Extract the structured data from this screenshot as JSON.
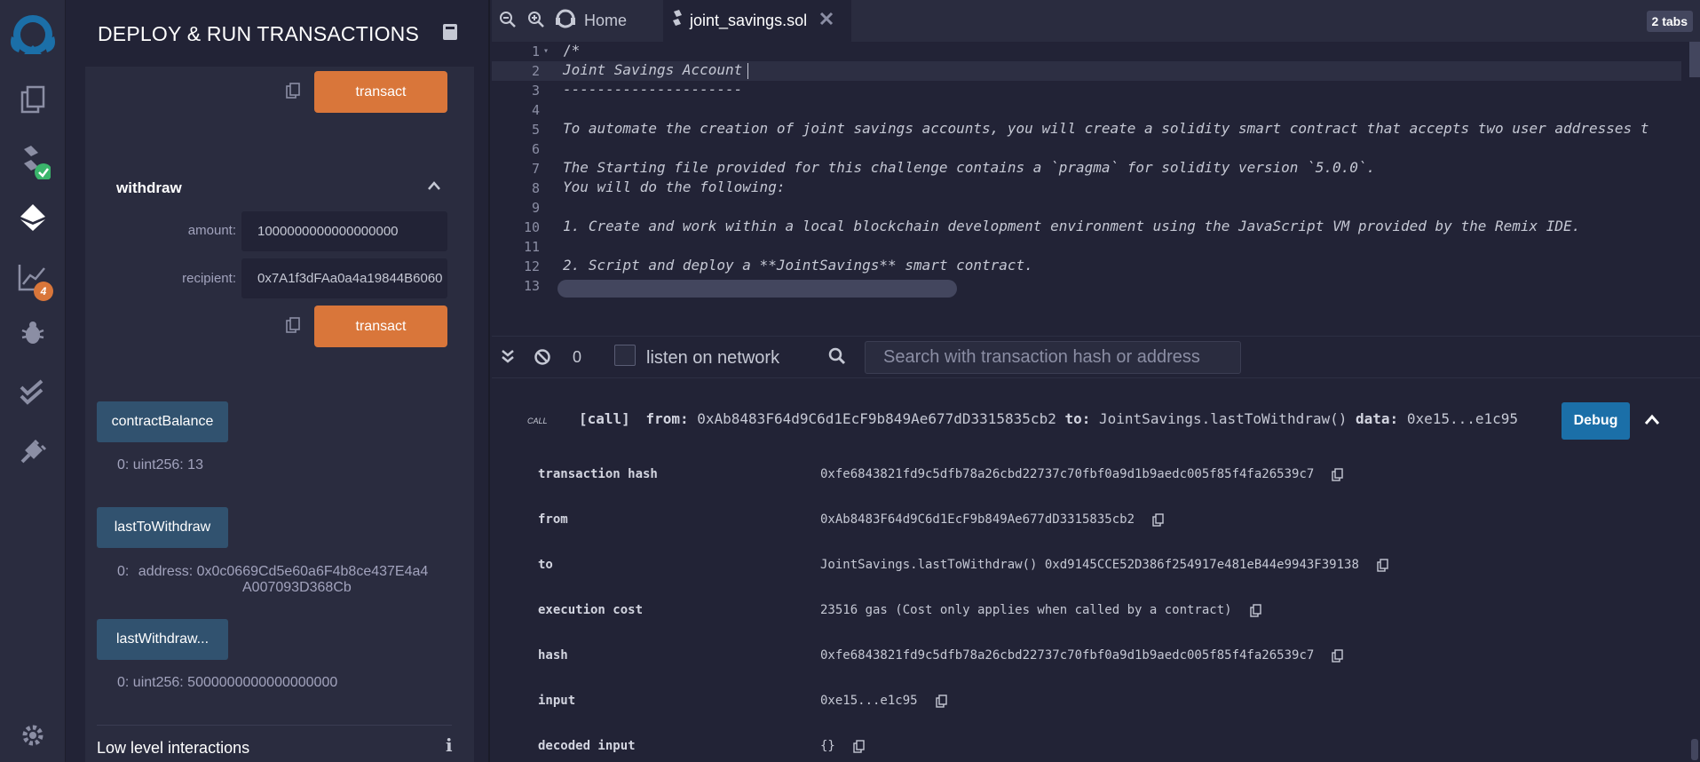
{
  "rail": {
    "plugin_badge_count": "4",
    "colors": {
      "badge_green": "#3ab56b",
      "badge_orange": "#d9763a"
    }
  },
  "panel": {
    "title": "DEPLOY & RUN TRANSACTIONS",
    "transact_label": "transact",
    "withdraw": {
      "title": "withdraw",
      "amount_label": "amount:",
      "amount_value": "1000000000000000000",
      "recipient_label": "recipient:",
      "recipient_value": "0x7A1f3dFAa0a4a19844B6060"
    },
    "getters": [
      {
        "label": "contractBalance",
        "output_index": "0:",
        "output_value": "uint256: 13"
      },
      {
        "label": "lastToWithdraw",
        "output_index": "0:",
        "output_value": "address: 0x0c0669Cd5e60a6F4b8ce437E4a4",
        "output_value_2": "A007093D368Cb"
      },
      {
        "label": "lastWithdraw...",
        "output_index": "0:",
        "output_value": "uint256: 5000000000000000000"
      }
    ],
    "low_level_title": "Low level interactions"
  },
  "tabs": {
    "home_label": "Home",
    "file_label": "joint_savings.sol",
    "count_label": "2 tabs"
  },
  "editor": {
    "lines": [
      {
        "num": "1",
        "text": "/*"
      },
      {
        "num": "2",
        "text": "Joint Savings Account"
      },
      {
        "num": "3",
        "text": "---------------------"
      },
      {
        "num": "4",
        "text": ""
      },
      {
        "num": "5",
        "text": "To automate the creation of joint savings accounts, you will create a solidity smart contract that accepts two user addresses t"
      },
      {
        "num": "6",
        "text": ""
      },
      {
        "num": "7",
        "text": "The Starting file provided for this challenge contains a `pragma` for solidity version `5.0.0`."
      },
      {
        "num": "8",
        "text": "You will do the following:"
      },
      {
        "num": "9",
        "text": ""
      },
      {
        "num": "10",
        "text": "1. Create and work within a local blockchain development environment using the JavaScript VM provided by the Remix IDE."
      },
      {
        "num": "11",
        "text": ""
      },
      {
        "num": "12",
        "text": "2. Script and deploy a **JointSavings** smart contract."
      },
      {
        "num": "13",
        "text": ""
      }
    ]
  },
  "terminal": {
    "pending_count": "0",
    "listen_label": "listen on network",
    "search_placeholder": "Search with transaction hash or address",
    "call_tag": "CALL",
    "call_kind": "[call]",
    "from_label": "from:",
    "from_value": "0xAb8483F64d9C6d1EcF9b849Ae677dD3315835cb2",
    "to_label": "to:",
    "to_value": "JointSavings.lastToWithdraw()",
    "data_label": "data:",
    "data_value": "0xe15...e1c95",
    "debug_label": "Debug",
    "rows": [
      {
        "key": "transaction hash",
        "value": "0xfe6843821fd9c5dfb78a26cbd22737c70fbf0a9d1b9aedc005f85f4fa26539c7"
      },
      {
        "key": "from",
        "value": "0xAb8483F64d9C6d1EcF9b849Ae677dD3315835cb2"
      },
      {
        "key": "to",
        "value": "JointSavings.lastToWithdraw() 0xd9145CCE52D386f254917e481eB44e9943F39138"
      },
      {
        "key": "execution cost",
        "value": "23516 gas (Cost only applies when called by a contract)"
      },
      {
        "key": "hash",
        "value": "0xfe6843821fd9c5dfb78a26cbd22737c70fbf0a9d1b9aedc005f85f4fa26539c7"
      },
      {
        "key": "input",
        "value": "0xe15...e1c95"
      },
      {
        "key": "decoded input",
        "value": "{}"
      }
    ]
  }
}
